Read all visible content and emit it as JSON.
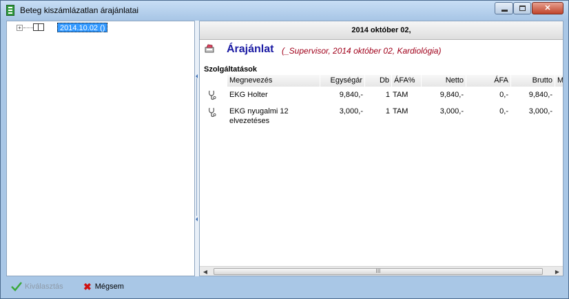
{
  "window": {
    "title": "Beteg kiszámlázatlan árajánlatai",
    "controls": {
      "minimize": "minimize-icon",
      "maximize": "maximize-icon",
      "close": "close-icon"
    }
  },
  "tree": {
    "expander": "+",
    "items": [
      {
        "label": "2014.10.02 ()",
        "selected": true
      }
    ]
  },
  "detail": {
    "date_header": "2014 október 02,",
    "quote_title": "Árajánlat",
    "quote_subtitle": "(_Supervisor, 2014 október 02, Kardiológia)",
    "section_label": "Szolgáltatások",
    "columns": [
      "Megnevezés",
      "Egységár",
      "Db",
      "ÁFA%",
      "Netto",
      "ÁFA",
      "Brutto",
      "Me"
    ],
    "rows": [
      {
        "name": "EKG Holter",
        "unit_price": "9,840,-",
        "qty": "1",
        "vat_pct": "TAM",
        "net": "9,840,-",
        "vat": "0,-",
        "gross": "9,840,-"
      },
      {
        "name_line1": "EKG nyugalmi 12",
        "name_line2": "elvezetéses",
        "unit_price": "3,000,-",
        "qty": "1",
        "vat_pct": "TAM",
        "net": "3,000,-",
        "vat": "0,-",
        "gross": "3,000,-"
      }
    ],
    "scroll_grip": "III"
  },
  "footer": {
    "select_label": "Kiválasztás",
    "cancel_label": "Mégsem"
  },
  "colors": {
    "title_blue": "#1a1aa3",
    "subtitle_red": "#a0001a",
    "selection": "#3399ff",
    "frame": "#a9c7e6"
  }
}
